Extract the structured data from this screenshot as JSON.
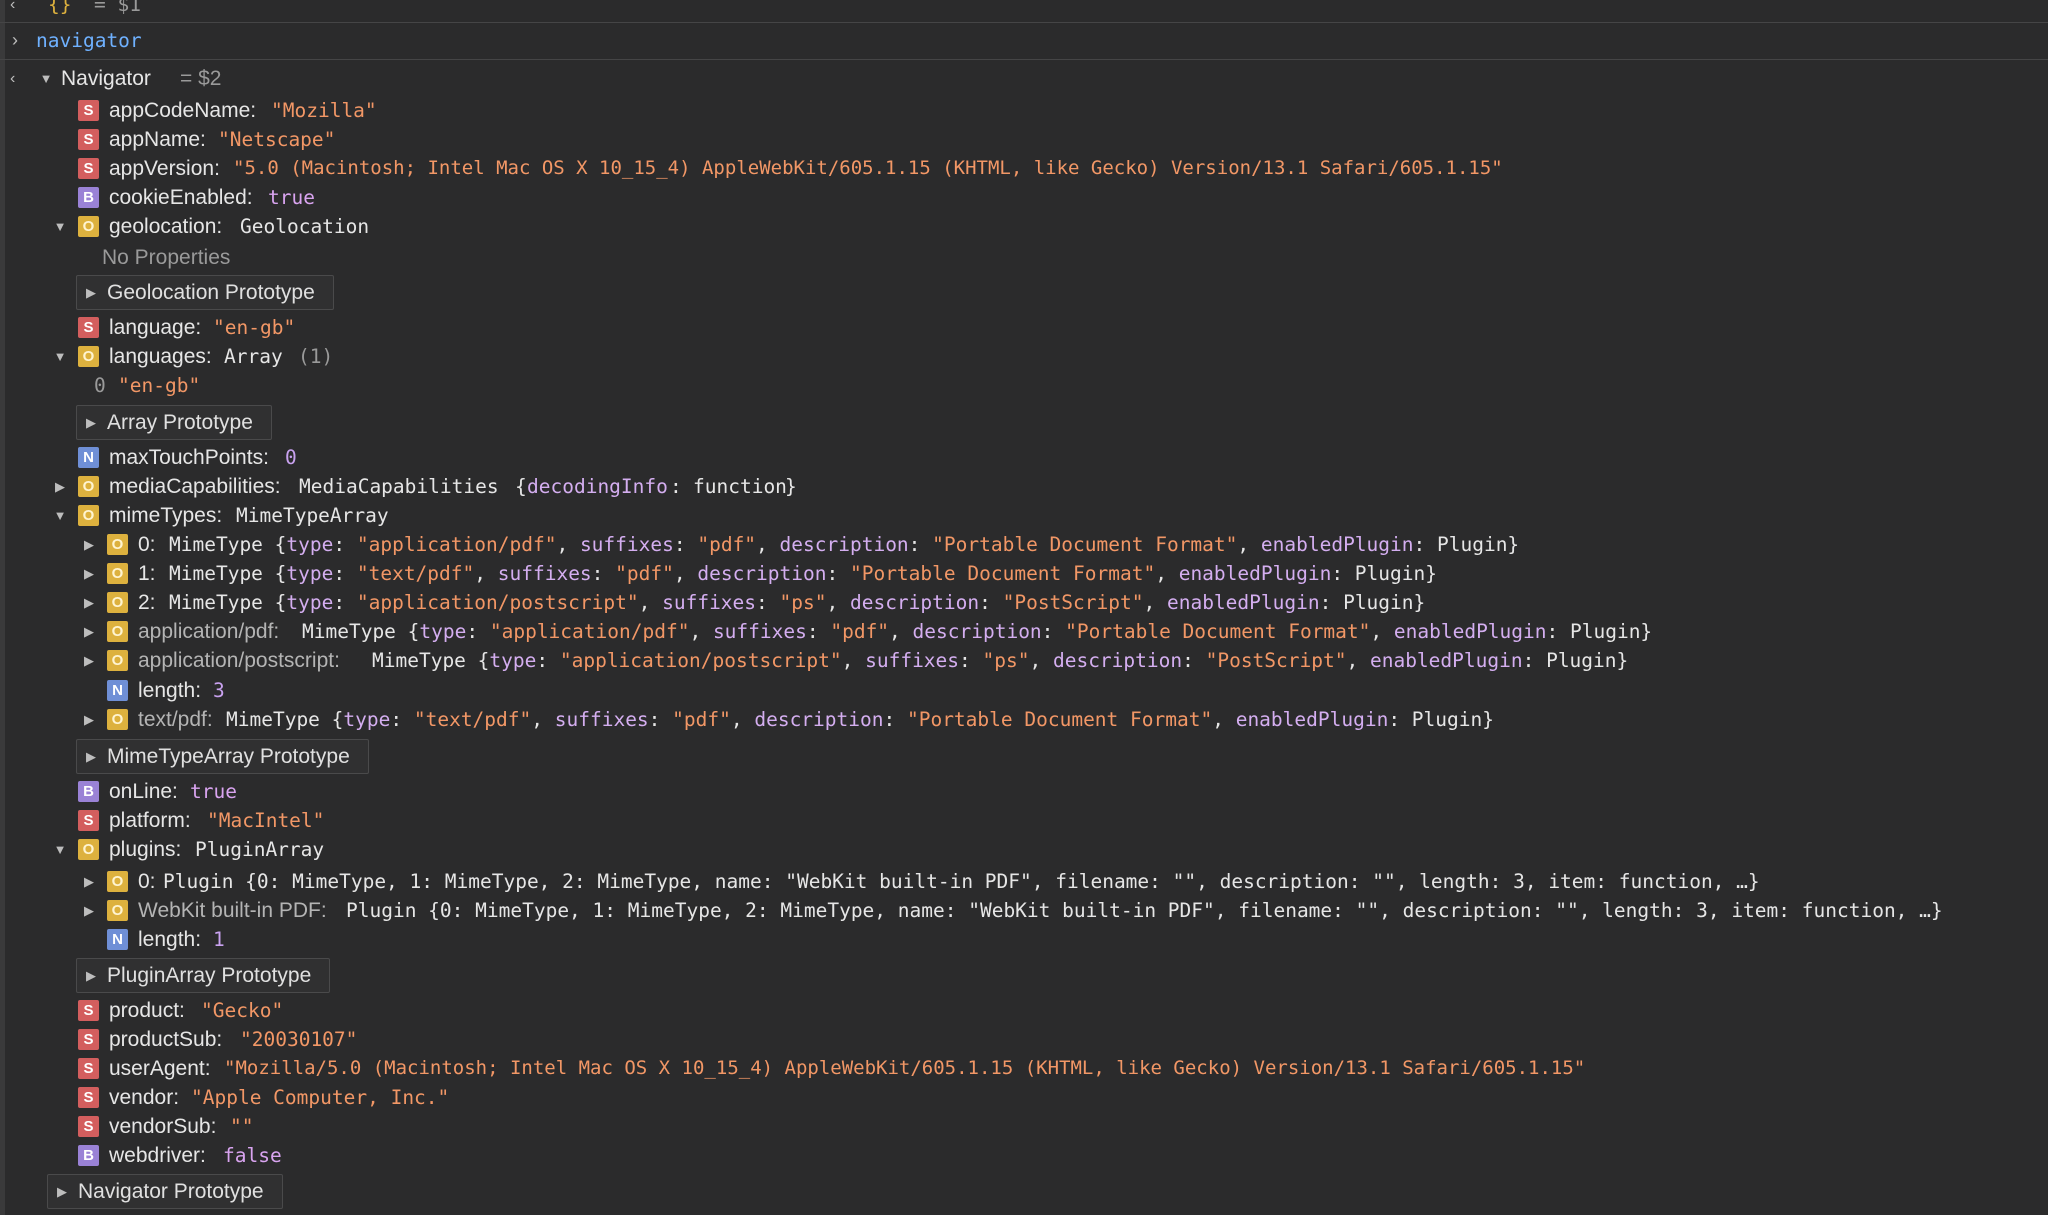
{
  "console": {
    "prev_result_label": "= $1",
    "prev_object_glyph": "{}",
    "input_command": "navigator",
    "result_class": "Navigator",
    "result_ref": "= $2"
  },
  "properties": [
    {
      "id": "appCodeName",
      "badge": "S",
      "name": "appCodeName:",
      "value": "\"Mozilla\"",
      "value_type": "str"
    },
    {
      "id": "appName",
      "badge": "S",
      "name": "appName:",
      "value": "\"Netscape\"",
      "value_type": "str"
    },
    {
      "id": "appVersion",
      "badge": "S",
      "name": "appVersion:",
      "value": "\"5.0 (Macintosh; Intel Mac OS X 10_15_4) AppleWebKit/605.1.15 (KHTML, like Gecko) Version/13.1 Safari/605.1.15\"",
      "value_type": "str"
    },
    {
      "id": "cookieEnabled",
      "badge": "B",
      "name": "cookieEnabled:",
      "value": "true",
      "value_type": "bool"
    }
  ],
  "geolocation": {
    "name": "geolocation:",
    "value": "Geolocation",
    "empty_label": "No Properties",
    "prototype_label": "Geolocation Prototype"
  },
  "language": {
    "name": "language:",
    "value": "\"en-gb\""
  },
  "languages": {
    "name": "languages:",
    "value": "Array",
    "count": "(1)",
    "items": [
      {
        "index": "0",
        "value": "\"en-gb\""
      }
    ],
    "prototype_label": "Array Prototype"
  },
  "maxTouchPoints": {
    "name": "maxTouchPoints:",
    "value": "0"
  },
  "mediaCapabilities": {
    "name": "mediaCapabilities:",
    "class": "MediaCapabilities",
    "preview_open": "{",
    "preview_key": "decodingInfo",
    "preview_sep": ":",
    "preview_val": "function",
    "preview_close": "}"
  },
  "mimeTypes": {
    "name": "mimeTypes:",
    "value": "MimeTypeArray",
    "items": [
      {
        "key": "0:",
        "key_style": "normal",
        "cls": "MimeType",
        "type": "\"application/pdf\"",
        "suffixes": "\"pdf\"",
        "description": "\"Portable Document Format\""
      },
      {
        "key": "1:",
        "key_style": "normal",
        "cls": "MimeType",
        "type": "\"text/pdf\"",
        "suffixes": "\"pdf\"",
        "description": "\"Portable Document Format\""
      },
      {
        "key": "2:",
        "key_style": "normal",
        "cls": "MimeType",
        "type": "\"application/postscript\"",
        "suffixes": "\"ps\"",
        "description": "\"PostScript\""
      },
      {
        "key": "application/pdf:",
        "key_style": "dim",
        "cls": "MimeType",
        "type": "\"application/pdf\"",
        "suffixes": "\"pdf\"",
        "description": "\"Portable Document Format\""
      },
      {
        "key": "application/postscript:",
        "key_style": "dim",
        "cls": "MimeType",
        "type": "\"application/postscript\"",
        "suffixes": "\"ps\"",
        "description": "\"PostScript\""
      }
    ],
    "length": {
      "name": "length:",
      "value": "3"
    },
    "last": {
      "key": "text/pdf:",
      "cls": "MimeType",
      "type": "\"text/pdf\"",
      "suffixes": "\"pdf\"",
      "description": "\"Portable Document Format\""
    },
    "prototype_label": "MimeTypeArray Prototype",
    "k_type": "type",
    "k_suffixes": "suffixes",
    "k_description": "description",
    "k_enabledPlugin": "enabledPlugin",
    "v_plugin": "Plugin"
  },
  "onLine": {
    "name": "onLine:",
    "value": "true"
  },
  "platform": {
    "name": "platform:",
    "value": "\"MacIntel\""
  },
  "plugins": {
    "name": "plugins:",
    "value": "PluginArray",
    "item0": {
      "key": "0:",
      "preview": "Plugin {0: MimeType, 1: MimeType, 2: MimeType, name: \"WebKit built-in PDF\", filename: \"\", description: \"\", length: 3, item: function, …}"
    },
    "item1": {
      "key": "WebKit built-in PDF:",
      "preview": "Plugin {0: MimeType, 1: MimeType, 2: MimeType, name: \"WebKit built-in PDF\", filename: \"\", description: \"\", length: 3, item: function, …}"
    },
    "length": {
      "name": "length:",
      "value": "1"
    },
    "prototype_label": "PluginArray Prototype"
  },
  "tail_properties": [
    {
      "id": "product",
      "badge": "S",
      "name": "product:",
      "value": "\"Gecko\"",
      "value_type": "str"
    },
    {
      "id": "productSub",
      "badge": "S",
      "name": "productSub:",
      "value": "\"20030107\"",
      "value_type": "str"
    },
    {
      "id": "userAgent",
      "badge": "S",
      "name": "userAgent:",
      "value": "\"Mozilla/5.0 (Macintosh; Intel Mac OS X 10_15_4) AppleWebKit/605.1.15 (KHTML, like Gecko) Version/13.1 Safari/605.1.15\"",
      "value_type": "str"
    },
    {
      "id": "vendor",
      "badge": "S",
      "name": "vendor:",
      "value": "\"Apple Computer, Inc.\"",
      "value_type": "str"
    },
    {
      "id": "vendorSub",
      "badge": "S",
      "name": "vendorSub:",
      "value": "\"\"",
      "value_type": "str"
    },
    {
      "id": "webdriver",
      "badge": "B",
      "name": "webdriver:",
      "value": "false",
      "value_type": "bool"
    }
  ],
  "navigator_prototype_label": "Navigator Prototype",
  "colors": {
    "background": "#2b2b2c",
    "string": "#f29766",
    "keyword": "#c9a2f0",
    "command": "#6fb1ff"
  }
}
